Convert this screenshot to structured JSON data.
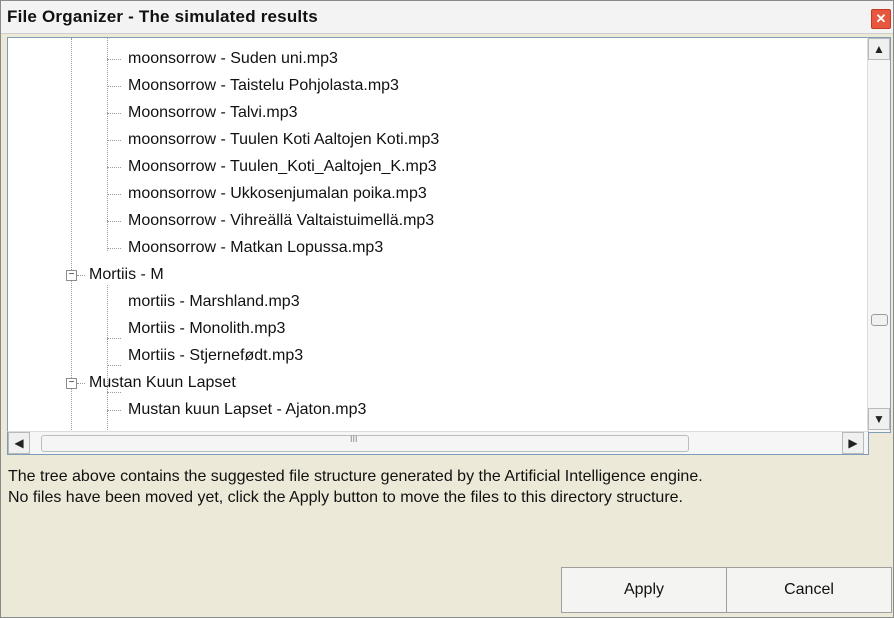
{
  "window": {
    "title": "File Organizer - The simulated results",
    "close_glyph": "✕"
  },
  "tree": {
    "files_above": [
      "moonsorrow - Suden uni.mp3",
      "Moonsorrow - Taistelu Pohjolasta.mp3",
      "Moonsorrow - Talvi.mp3",
      "moonsorrow - Tuulen Koti Aaltojen Koti.mp3",
      "Moonsorrow - Tuulen_Koti_Aaltojen_K.mp3",
      "moonsorrow - Ukkosenjumalan poika.mp3",
      "Moonsorrow - Vihreällä Valtaistuimellä.mp3",
      "Moonsorrow - Matkan Lopussa.mp3"
    ],
    "folders": [
      {
        "name": "Mortiis - M",
        "expanded": true,
        "files": [
          "mortiis - Marshland.mp3",
          "Mortiis - Monolith.mp3",
          "Mortiis - Stjernefødt.mp3"
        ]
      },
      {
        "name": "Mustan Kuun Lapset",
        "expanded": true,
        "files": [
          "Mustan kuun Lapset - Ajaton.mp3"
        ]
      }
    ],
    "expander_glyph": "−"
  },
  "scrollbar": {
    "up": "▲",
    "down": "▼",
    "left": "◀",
    "right": "▶",
    "grip": "III"
  },
  "description": {
    "line1": "The tree above contains the suggested file structure generated by the Artificial Intelligence engine.",
    "line2": "No files have been moved yet, click the Apply button to move the files to this directory structure."
  },
  "buttons": {
    "apply": "Apply",
    "cancel": "Cancel"
  }
}
